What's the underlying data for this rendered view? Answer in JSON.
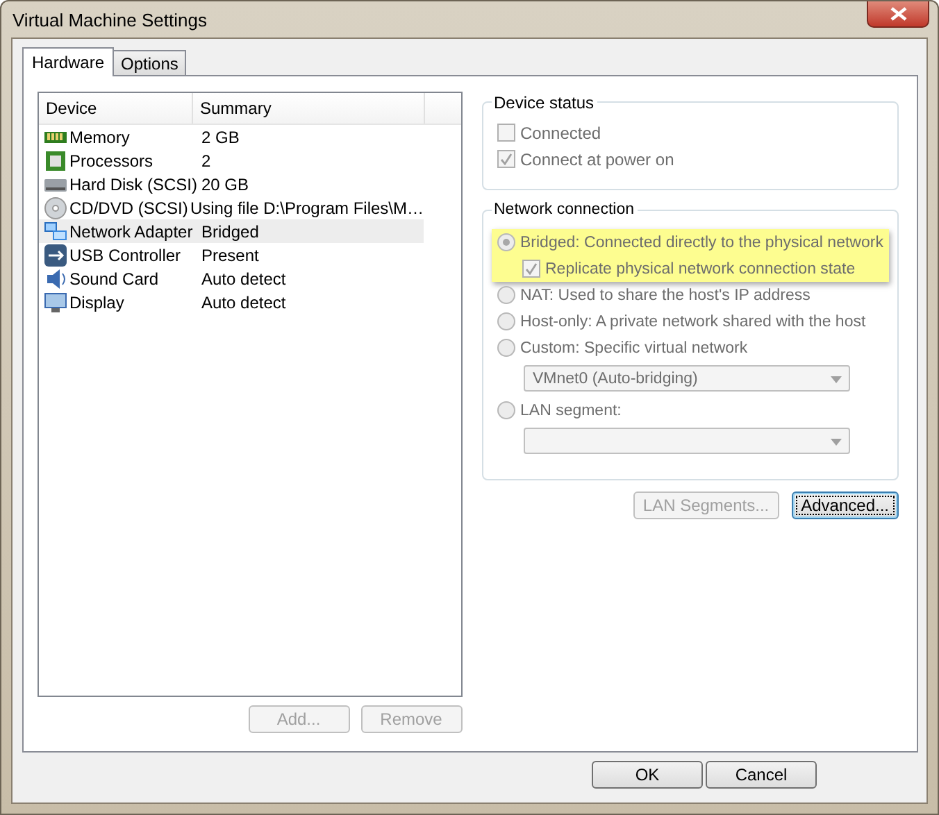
{
  "window": {
    "title": "Virtual Machine Settings"
  },
  "tabs": [
    {
      "label": "Hardware",
      "selected": true
    },
    {
      "label": "Options",
      "selected": false
    }
  ],
  "device_list": {
    "columns": [
      "Device",
      "Summary"
    ],
    "rows": [
      {
        "kind": "memory",
        "device": "Memory",
        "summary": "2 GB",
        "selected": false
      },
      {
        "kind": "processor",
        "device": "Processors",
        "summary": "2",
        "selected": false
      },
      {
        "kind": "disk",
        "device": "Hard Disk (SCSI)",
        "summary": "20 GB",
        "selected": false
      },
      {
        "kind": "cd",
        "device": "CD/DVD (SCSI)",
        "summary": "Using file D:\\Program Files\\M…",
        "selected": false
      },
      {
        "kind": "network",
        "device": "Network Adapter",
        "summary": "Bridged",
        "selected": true
      },
      {
        "kind": "usb",
        "device": "USB Controller",
        "summary": "Present",
        "selected": false
      },
      {
        "kind": "sound",
        "device": "Sound Card",
        "summary": "Auto detect",
        "selected": false
      },
      {
        "kind": "display",
        "device": "Display",
        "summary": "Auto detect",
        "selected": false
      }
    ],
    "buttons": [
      {
        "label": "Add...",
        "disabled": true
      },
      {
        "label": "Remove",
        "disabled": true
      }
    ]
  },
  "device_status": {
    "title": "Device status",
    "options": [
      {
        "label": "Connected",
        "checked": false,
        "disabled": true
      },
      {
        "label": "Connect at power on",
        "checked": true,
        "disabled": true
      }
    ]
  },
  "network_connection": {
    "title": "Network connection",
    "options": [
      {
        "label": "Bridged: Connected directly to the physical network",
        "selected": true,
        "disabled": true,
        "highlighted": true,
        "sub_option": {
          "label": "Replicate physical network connection state",
          "checked": true,
          "disabled": true
        }
      },
      {
        "label": "NAT: Used to share the host's IP address",
        "selected": false,
        "disabled": true,
        "highlighted": false
      },
      {
        "label": "Host-only: A private network shared with the host",
        "selected": false,
        "disabled": true,
        "highlighted": false
      },
      {
        "label": "Custom: Specific virtual network",
        "selected": false,
        "disabled": true,
        "highlighted": false,
        "dropdown": {
          "value": "VMnet0 (Auto-bridging)",
          "disabled": true
        }
      },
      {
        "label": "LAN segment:",
        "selected": false,
        "disabled": true,
        "highlighted": false,
        "dropdown": {
          "disabled": true
        }
      }
    ]
  },
  "network_buttons": [
    {
      "label": "LAN Segments...",
      "disabled": true,
      "focused": false
    },
    {
      "label": "Advanced...",
      "disabled": false,
      "focused": true
    }
  ],
  "dialog_buttons": [
    {
      "label": "OK"
    },
    {
      "label": "Cancel"
    }
  ]
}
